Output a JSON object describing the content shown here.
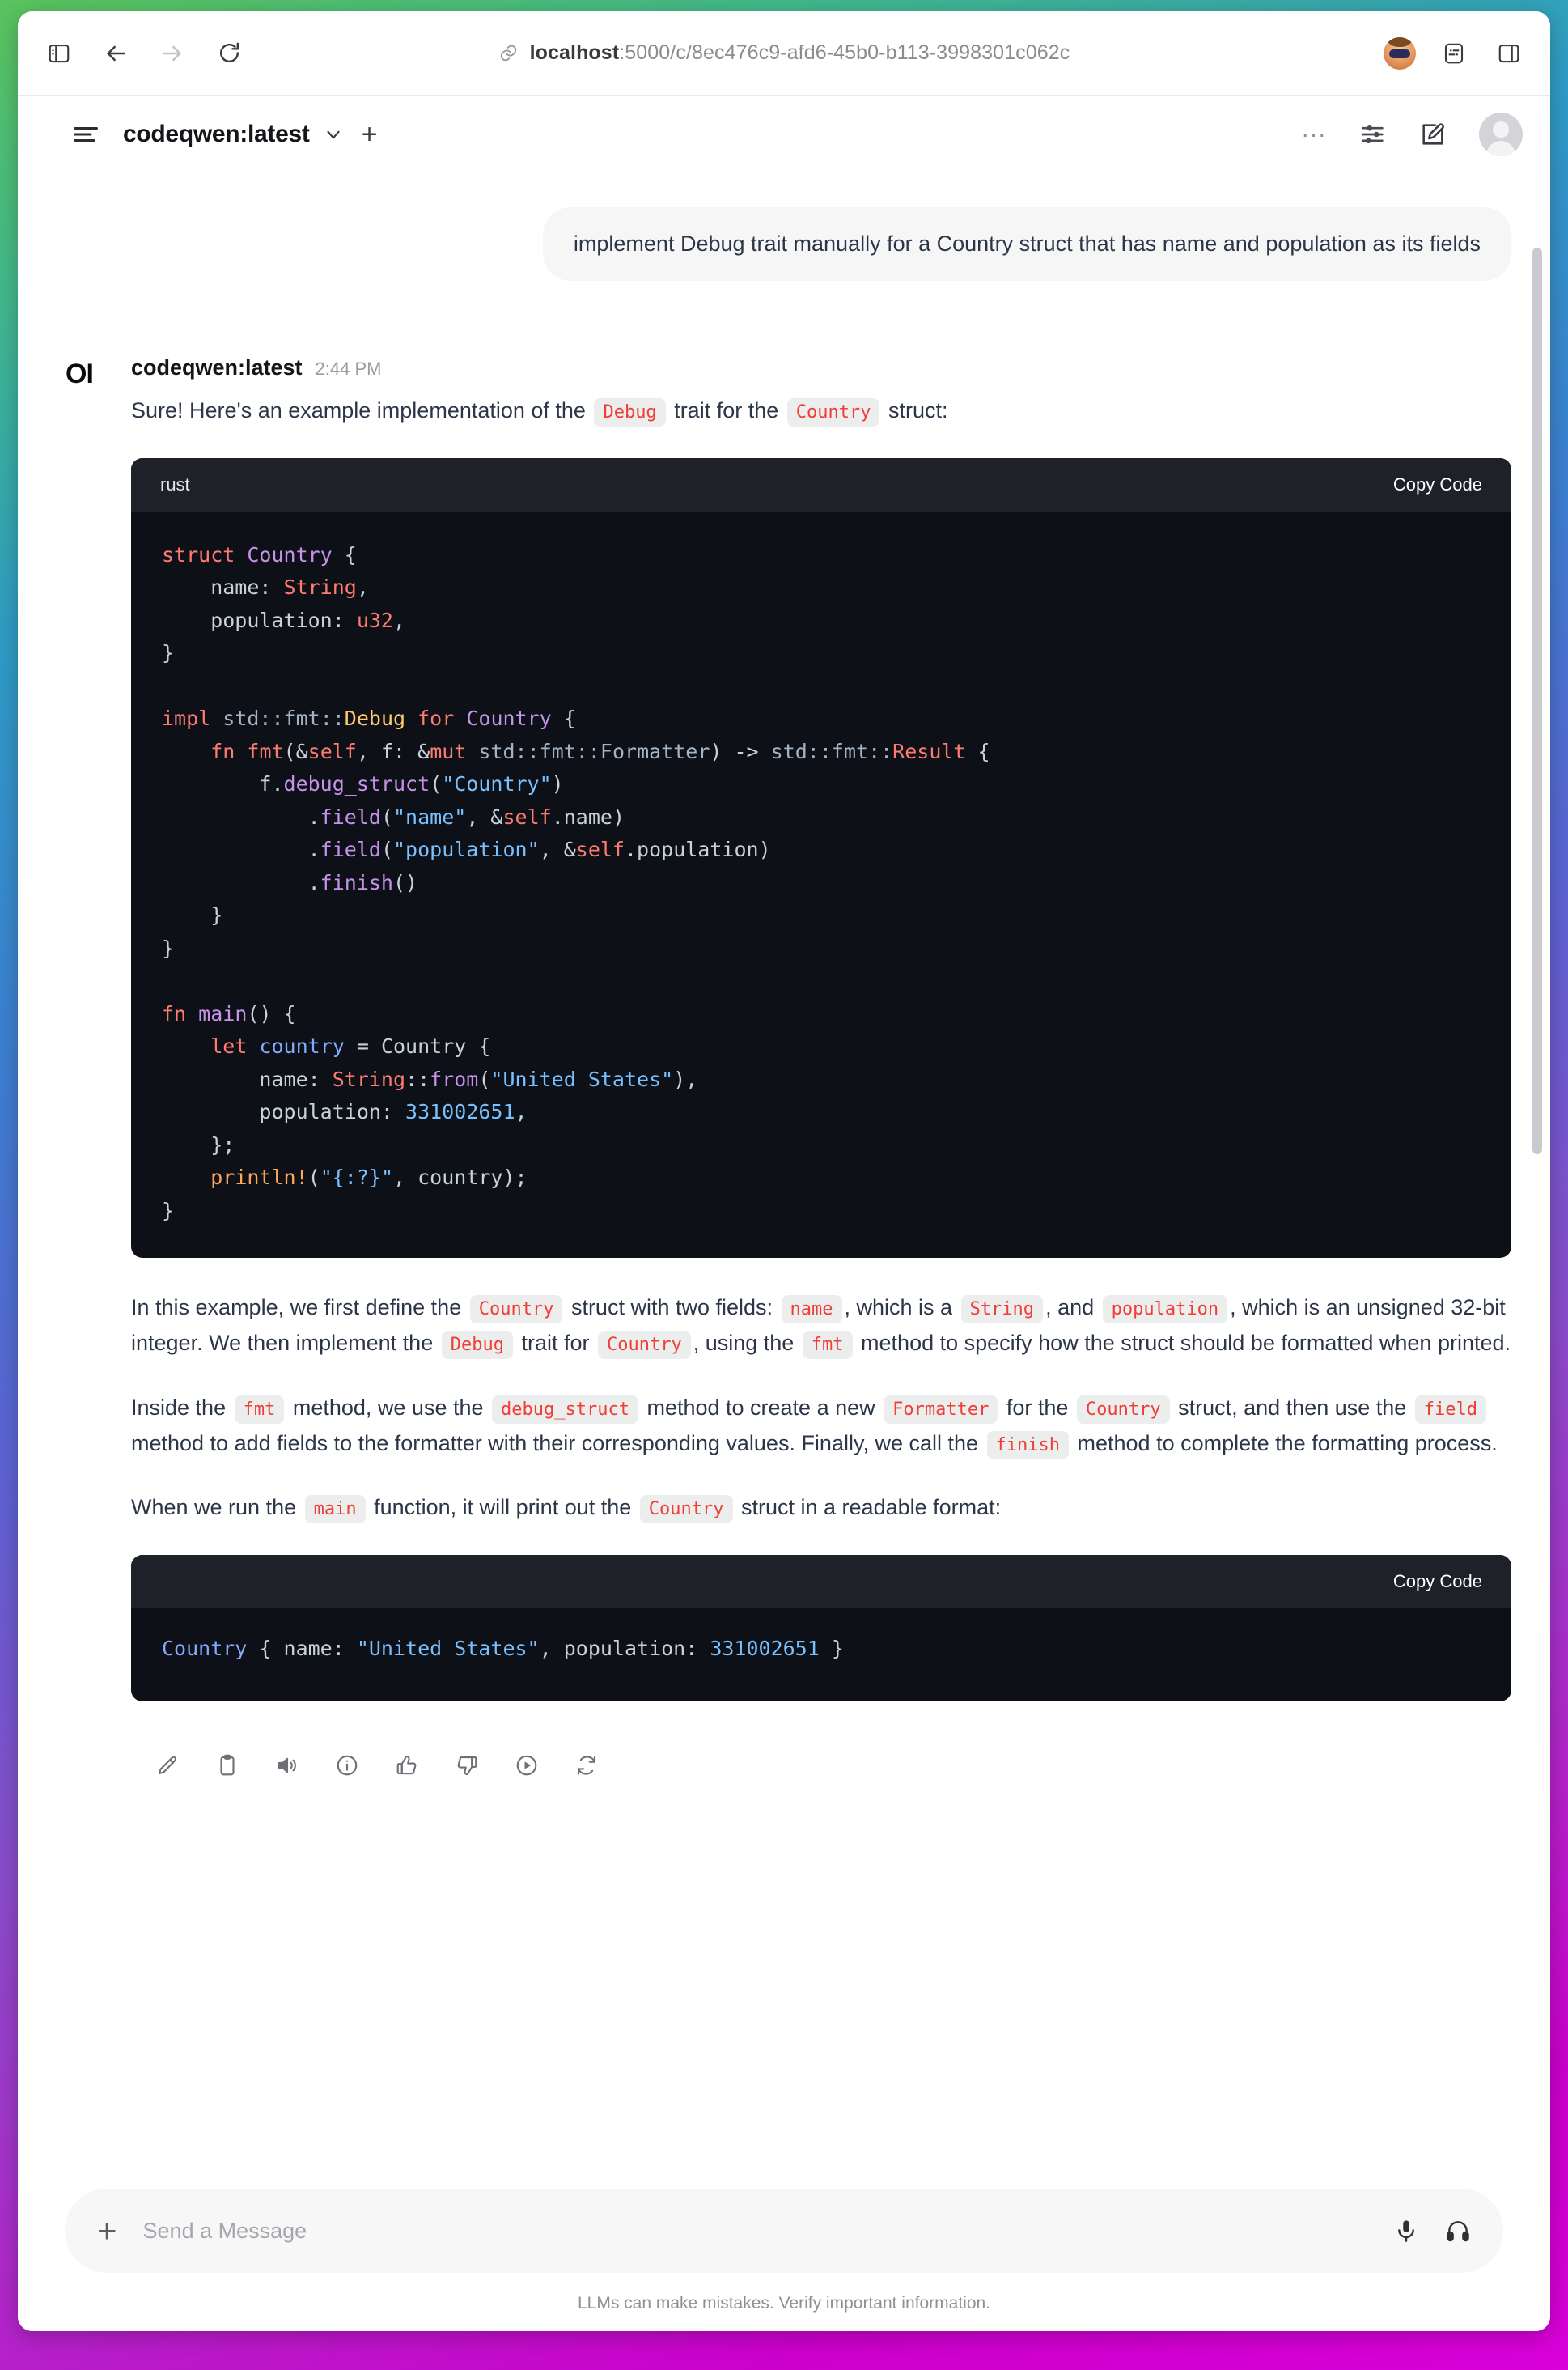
{
  "browser": {
    "url_host": "localhost",
    "url_path": ":5000/c/8ec476c9-afd6-45b0-b113-3998301c062c",
    "back_icon": "back-arrow-icon",
    "forward_icon": "forward-arrow-icon",
    "reload_icon": "reload-icon",
    "sidebar_icon": "sidebar-toggle-icon",
    "link_icon": "link-icon",
    "extension_icon": "extensions-icon",
    "panel_icon": "side-panel-icon"
  },
  "app_header": {
    "title": "codeqwen:latest",
    "menu_icon": "hamburger-menu-icon",
    "model_chevron": "chevron-down-icon",
    "new_chat": "+",
    "more": "...",
    "controls_icon": "sliders-icon",
    "edit_icon": "compose-icon",
    "avatar_icon": "user-avatar-icon"
  },
  "conversation": {
    "user_message": "implement Debug trait manually for a Country struct that has name and population as its fields",
    "assistant": {
      "avatar_mark": "OI",
      "name": "codeqwen:latest",
      "time": "2:44 PM",
      "intro": {
        "part1": "Sure! Here's an example implementation of the ",
        "code1": "Debug",
        "part2": " trait for the ",
        "code2": "Country",
        "part3": " struct:"
      },
      "code_block_1": {
        "language": "rust",
        "copy_label": "Copy Code",
        "lines": [
          "struct Country {",
          "    name: String,",
          "    population: u32,",
          "}",
          "",
          "impl std::fmt::Debug for Country {",
          "    fn fmt(&self, f: &mut std::fmt::Formatter) -> std::fmt::Result {",
          "        f.debug_struct(\"Country\")",
          "            .field(\"name\", &self.name)",
          "            .field(\"population\", &self.population)",
          "            .finish()",
          "    }",
          "}",
          "",
          "fn main() {",
          "    let country = Country {",
          "        name: String::from(\"United States\"),",
          "        population: 331002651,",
          "    };",
          "    println!(\"{:?}\", country);",
          "}"
        ]
      },
      "paragraph_2": {
        "s1": "In this example, we first define the ",
        "c1": "Country",
        "s2": " struct with two fields: ",
        "c2": "name",
        "s3": ", which is a ",
        "c3": "String",
        "s4": ", and ",
        "c4": "population",
        "s5": ", which is an unsigned 32-bit integer. We then implement the ",
        "c5": "Debug",
        "s6": " trait for ",
        "c6": "Country",
        "s7": ", using the ",
        "c7": "fmt",
        "s8": " method to specify how the struct should be formatted when printed."
      },
      "paragraph_3": {
        "s1": "Inside the ",
        "c1": "fmt",
        "s2": " method, we use the ",
        "c2": "debug_struct",
        "s3": " method to create a new ",
        "c3": "Formatter",
        "s4": " for the ",
        "c4": "Country",
        "s5": " struct, and then use the ",
        "c5": "field",
        "s6": " method to add fields to the formatter with their corresponding values. Finally, we call the ",
        "c6": "finish",
        "s7": " method to complete the formatting process."
      },
      "paragraph_4": {
        "s1": "When we run the ",
        "c1": "main",
        "s2": " function, it will print out the ",
        "c2": "Country",
        "s3": " struct in a readable format:"
      },
      "code_block_2": {
        "language": "",
        "copy_label": "Copy Code",
        "output_struct": "Country",
        "output_rest": " { name: ",
        "output_name": "\"United States\"",
        "output_mid": ", population: ",
        "output_pop": "331002651",
        "output_end": " }"
      },
      "actions": [
        {
          "name": "edit-icon",
          "label": "Edit"
        },
        {
          "name": "copy-icon",
          "label": "Copy"
        },
        {
          "name": "speaker-icon",
          "label": "Read aloud"
        },
        {
          "name": "info-icon",
          "label": "Info"
        },
        {
          "name": "thumbs-up-icon",
          "label": "Good response"
        },
        {
          "name": "thumbs-down-icon",
          "label": "Bad response"
        },
        {
          "name": "play-circle-icon",
          "label": "Continue"
        },
        {
          "name": "regenerate-icon",
          "label": "Regenerate"
        }
      ]
    }
  },
  "composer": {
    "plus": "+",
    "placeholder": "Send a Message",
    "value": "",
    "mic_icon": "microphone-icon",
    "headphones_icon": "headphones-icon",
    "disclaimer": "LLMs can make mistakes. Verify important information."
  },
  "colors": {
    "inline_code": "#ef3e36",
    "code_bg": "#0d1117",
    "code_header_bg": "#1e2127",
    "text": "#2c3648"
  }
}
